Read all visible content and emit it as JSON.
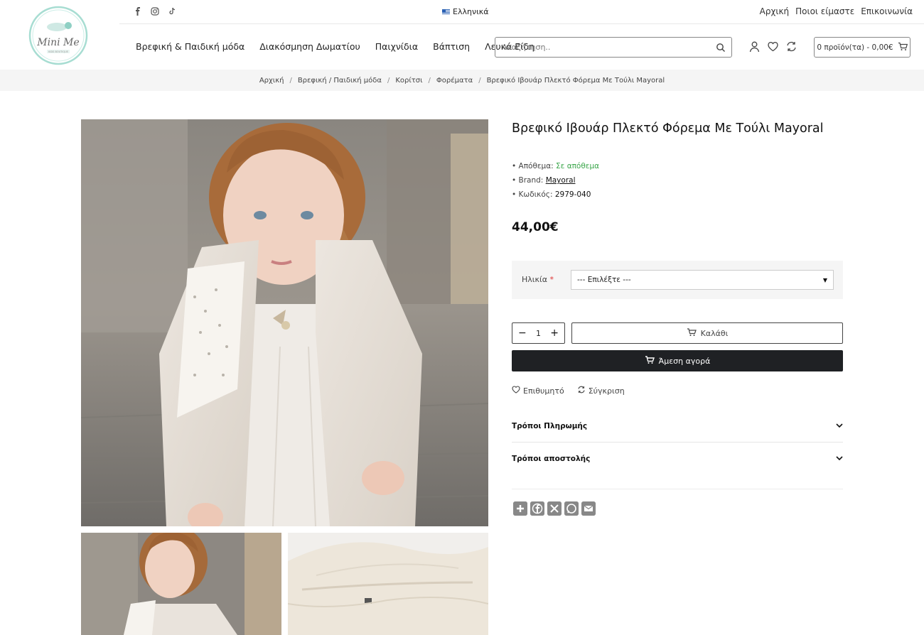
{
  "header": {
    "logo_text": "Mini Me",
    "logo_subtext": "KIDS BOUTIQUE",
    "language": "Ελληνικά",
    "top_links": [
      "Αρχική",
      "Ποιοι είμαστε",
      "Επικοινωνία"
    ],
    "nav": [
      "Βρεφική & Παιδική μόδα",
      "Διακόσμηση Δωματίου",
      "Παιχνίδια",
      "Βάπτιση",
      "Λευκά Είδη"
    ],
    "search_placeholder": "Αναζήτηση..",
    "cart_label": "0 προϊόν(τα) - 0,00€",
    "social_icons": [
      "facebook-icon",
      "instagram-icon",
      "tiktok-icon"
    ],
    "accent_color": "#8fd0c4"
  },
  "breadcrumb": [
    "Αρχική",
    "Βρεφική / Παιδική μόδα",
    "Κορίτσι",
    "Φορέματα",
    "Βρεφικό Ιβουάρ Πλεκτό Φόρεμα Με Τούλι Mayoral"
  ],
  "product": {
    "title": "Βρεφικό Ιβουάρ Πλεκτό Φόρεμα Με Τούλι Mayoral",
    "stock_label": "• Απόθεμα:",
    "stock_value": "Σε απόθεμα",
    "brand_label": "• Brand:",
    "brand_value": "Mayoral",
    "code_label": "• Κωδικός:",
    "code_value": "2979-040",
    "price": "44,00€",
    "option_label": "Ηλικία",
    "option_required": "*",
    "option_selected": "--- Επιλέξτε ---",
    "quantity": "1",
    "qty_minus": "−",
    "qty_plus": "+",
    "add_to_cart": "Καλάθι",
    "buy_now": "Άμεση αγορά",
    "wishlist": "Επιθυμητό",
    "compare": "Σύγκριση",
    "accordions": [
      "Τρόποι Πληρωμής",
      "Τρόποι αποστολής"
    ],
    "stock_color": "#3aa64a"
  },
  "share_icons": [
    "share-plus-icon",
    "facebook-share-icon",
    "x-share-icon",
    "whatsapp-share-icon",
    "email-share-icon"
  ]
}
